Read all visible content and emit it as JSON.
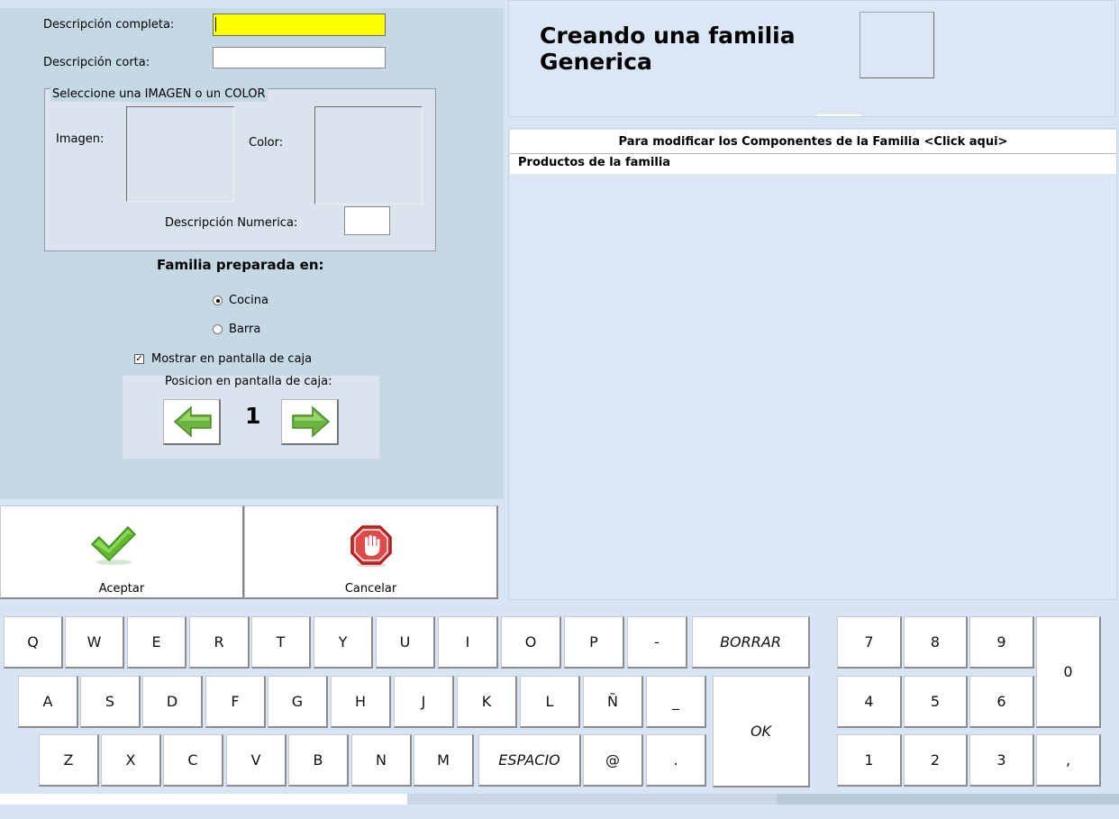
{
  "form": {
    "full_description_label": "Descripción completa:",
    "full_description_value": "",
    "short_description_label": "Descripción corta:",
    "short_description_value": "",
    "image_color_legend": "Seleccione una IMAGEN o un COLOR",
    "image_label": "Imagen:",
    "color_label": "Color:",
    "numeric_description_label": "Descripción Numerica:",
    "numeric_description_value": "",
    "prepared_in_title": "Familia preparada en:",
    "options": [
      {
        "label": "Cocina",
        "selected": true
      },
      {
        "label": "Barra",
        "selected": false
      }
    ],
    "show_on_cash_screen_label": "Mostrar en pantalla de caja",
    "show_on_cash_screen_checked": true,
    "position_label": "Posicion en pantalla de caja:",
    "position_value": "1"
  },
  "actions": {
    "accept_label": "Aceptar",
    "cancel_label": "Cancelar"
  },
  "header": {
    "title_line1": "Creando una familia",
    "title_line2": "Generica"
  },
  "components": {
    "header_text": "Para modificar los Componentes de la Familia <Click aqui>",
    "products_label": "Productos de la familia"
  },
  "keyboard": {
    "row1": [
      "Q",
      "W",
      "E",
      "R",
      "T",
      "Y",
      "U",
      "I",
      "O",
      "P",
      "-"
    ],
    "borrar": "BORRAR",
    "row2": [
      "A",
      "S",
      "D",
      "F",
      "G",
      "H",
      "J",
      "K",
      "L",
      "Ñ",
      "_"
    ],
    "ok": "OK",
    "row3": [
      "Z",
      "X",
      "C",
      "V",
      "B",
      "N",
      "M"
    ],
    "espacio": "ESPACIO",
    "row3_tail": [
      "@",
      "."
    ]
  },
  "numpad": {
    "keys": [
      "7",
      "8",
      "9",
      "4",
      "5",
      "6",
      "1",
      "2",
      "3"
    ],
    "zero": "0",
    "comma": ","
  },
  "colors": {
    "form_panel_bg": "#c5d9e5",
    "page_bg": "#d6e4f3",
    "highlight_input": "#ffff00",
    "accept_icon": "#5fb82e",
    "cancel_icon": "#d42b2b"
  }
}
